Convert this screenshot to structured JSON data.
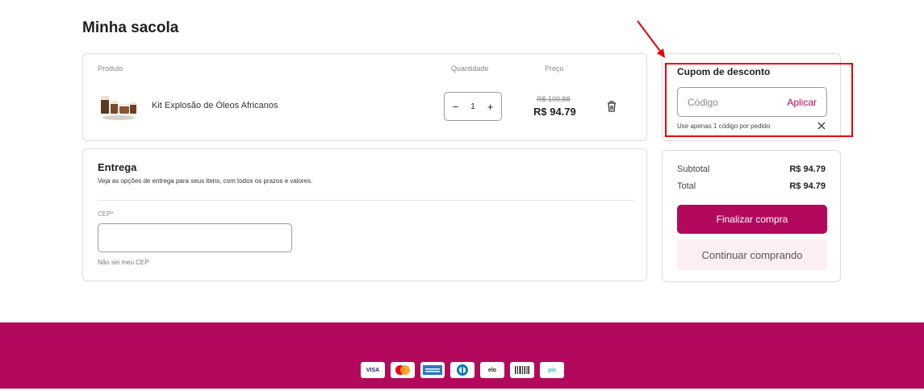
{
  "page": {
    "title": "Minha sacola"
  },
  "cart": {
    "headers": {
      "product": "Produto",
      "quantity": "Quantidade",
      "price": "Preço"
    },
    "item": {
      "name": "Kit Explosão de Óleos Africanos",
      "quantity": "1",
      "decrement": "−",
      "increment": "+",
      "old_price": "R$ 109,88",
      "price": "R$ 94.79",
      "remove_icon": "trash-icon"
    }
  },
  "delivery": {
    "title": "Entrega",
    "subtitle": "Veja as opções de entrega para seus itens, com todos os prazos e valores.",
    "cep_label": "CEP*",
    "cep_value": "",
    "cep_help": "Não sei meu CEP"
  },
  "coupon": {
    "title": "Cupom de desconto",
    "placeholder": "Código",
    "apply_label": "Aplicar",
    "note": "Use apenas 1 código por pedido",
    "close_icon": "close-icon"
  },
  "summary": {
    "subtotal_label": "Subtotal",
    "subtotal_value": "R$ 94.79",
    "total_label": "Total",
    "total_value": "R$ 94.79",
    "checkout_label": "Finalizar compra",
    "continue_label": "Continuar comprando"
  },
  "footer": {
    "payment_methods": [
      {
        "name": "visa",
        "label": "VISA"
      },
      {
        "name": "mastercard",
        "label": ""
      },
      {
        "name": "amex",
        "label": ""
      },
      {
        "name": "diners",
        "label": ""
      },
      {
        "name": "elo",
        "label": "elo"
      },
      {
        "name": "boleto",
        "label": ""
      },
      {
        "name": "pix",
        "label": "pix"
      }
    ]
  },
  "colors": {
    "brand": "#b3095d",
    "brand_light": "#fdeef1",
    "annotation": "#e8000b"
  }
}
